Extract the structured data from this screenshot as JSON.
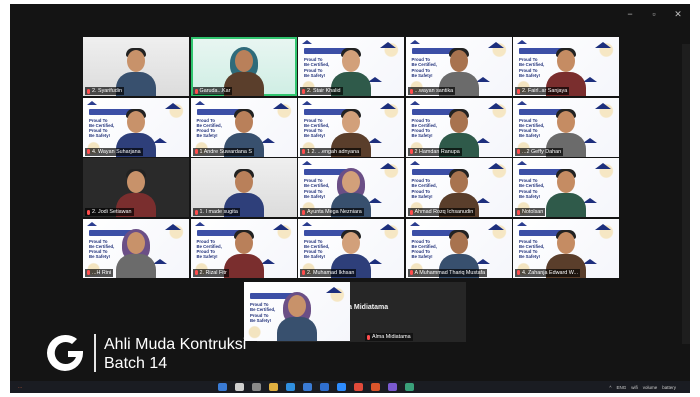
{
  "window": {
    "controls": [
      "minimize",
      "restore",
      "close"
    ],
    "control_glyphs": [
      "−",
      "▫",
      "✕"
    ]
  },
  "cert_text": "Proud To\nBe Certified,\nProud To\nBe Safety!",
  "participants": [
    {
      "name": "2. Syarifudin",
      "bg": "plain-room"
    },
    {
      "name": "Garuda...Kar",
      "bg": "plain-green",
      "active": true,
      "hijab": true
    },
    {
      "name": "2. Stair Khalid",
      "bg": "cert"
    },
    {
      "name": "...wayan santika",
      "bg": "cert"
    },
    {
      "name": "2. Fairl..ar Sanjaya",
      "bg": "cert"
    },
    {
      "name": "4. Wayan Suharjana",
      "bg": "cert"
    },
    {
      "name": "1 Andre Suwardana S",
      "bg": "cert"
    },
    {
      "name": "1 2. ...engah adnyana",
      "bg": "cert"
    },
    {
      "name": "2 Hamdan Ranupa",
      "bg": "cert"
    },
    {
      "name": "...2 Geffy Dahan",
      "bg": "cert"
    },
    {
      "name": "2. Jodi Setiawan",
      "bg": "plain-dark"
    },
    {
      "name": "1. I made sugita",
      "bg": "plain-room"
    },
    {
      "name": "Ayunta Mega Nezniara",
      "bg": "cert",
      "hijab": true
    },
    {
      "name": "Ahmad Rozq Ichsanudin",
      "bg": "cert"
    },
    {
      "name": "Notolsan",
      "bg": "cert"
    },
    {
      "name": "...H Rini",
      "bg": "cert",
      "hijab": true
    },
    {
      "name": "2. Rizal Fitr",
      "bg": "cert"
    },
    {
      "name": "2. Muhamad Ikhsan",
      "bg": "cert"
    },
    {
      "name": "A Muhammad Thariq Mustafa",
      "bg": "cert"
    },
    {
      "name": "4. Zahanja Edward W...",
      "bg": "cert"
    }
  ],
  "partial_tile": {
    "name": "",
    "bg": "cert",
    "hijab": true
  },
  "name_tile": {
    "display_name": "Alma Midiatama",
    "label": "Alma Midiatama"
  },
  "overlay": {
    "line1": "Ahli Muda Kontruksi",
    "line2": "Batch 14"
  },
  "colors": {
    "active_border": "#31c56f",
    "brand_navy": "#20307a",
    "overlay_text": "#ffffff"
  },
  "taskbar": {
    "left": "...",
    "right": [
      "^",
      "ENG",
      "wifi",
      "volume",
      "battery"
    ],
    "icons": [
      "windows-icon",
      "search-icon",
      "taskview-icon",
      "explorer-icon",
      "browser-icon",
      "store-icon",
      "mail-icon",
      "zoom-icon",
      "chrome-icon",
      "office-icon",
      "app-icon",
      "app-icon"
    ]
  }
}
